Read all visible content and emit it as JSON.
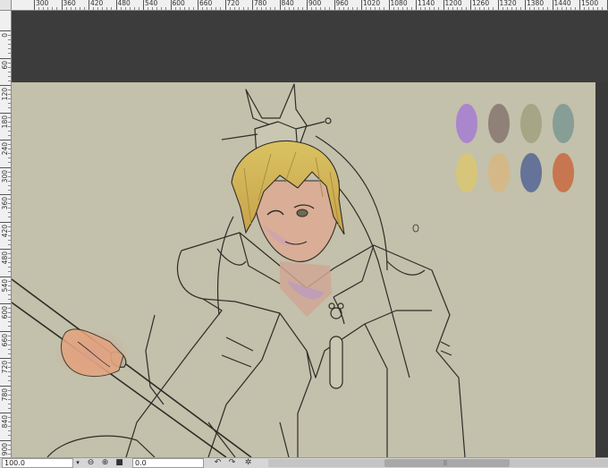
{
  "ruler": {
    "top_labels": [
      "300",
      "360",
      "420",
      "480",
      "540",
      "600",
      "660",
      "720",
      "780",
      "840",
      "900",
      "960",
      "1020",
      "1080",
      "1140",
      "1200",
      "1260",
      "1320",
      "1380",
      "1440",
      "1500",
      "1560",
      "1620",
      "1680"
    ],
    "left_labels": [
      "0",
      "60",
      "120",
      "180",
      "240",
      "300",
      "360",
      "420",
      "480",
      "540",
      "600",
      "660",
      "720",
      "780",
      "840",
      "900"
    ]
  },
  "statusbar": {
    "zoom_value": "100.0",
    "angle_value": "0.0",
    "zoom_dropdown_icon": "chevron-down-icon",
    "zoom_out_icon": "zoom-out-icon",
    "zoom_in_icon": "zoom-in-icon",
    "fit_icon": "fit-screen-icon",
    "rotate_left_icon": "rotate-left-icon",
    "rotate_right_icon": "rotate-right-icon",
    "reset_rotate_icon": "reset-rotation-icon",
    "grip": "||"
  },
  "palette": {
    "swatches": [
      "#a780cf",
      "#8b7a72",
      "#a3a281",
      "#7f9a94",
      "#d9c673",
      "#d7b783",
      "#5a6a95",
      "#c96e45"
    ]
  },
  "colors": {
    "workspace": "#3c3c3c",
    "artboard": "#c3c0ab",
    "lineart": "#2e2c27"
  }
}
